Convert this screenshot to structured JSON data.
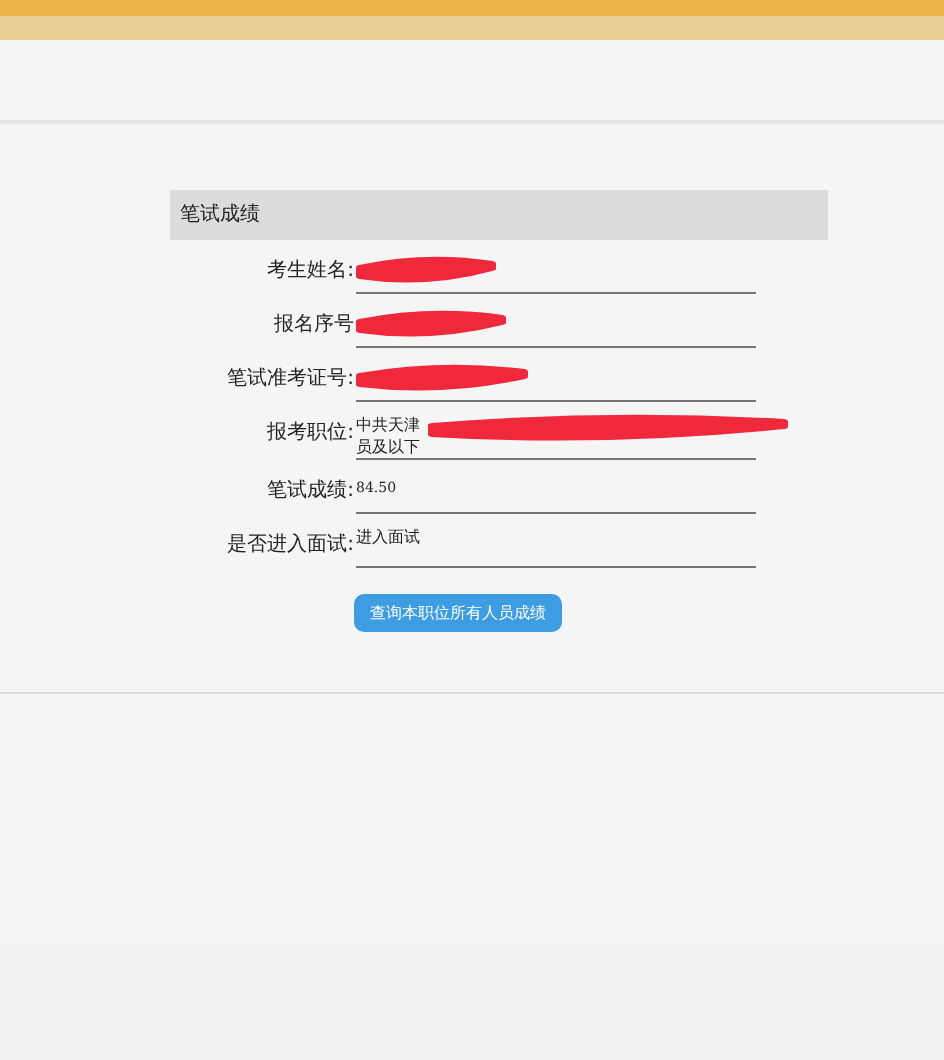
{
  "panel": {
    "title": "笔试成绩",
    "rows": [
      {
        "label": "考生姓名:",
        "redacted": true
      },
      {
        "label": "报名序号",
        "redacted": true
      },
      {
        "label": "笔试准考证号:",
        "redacted": true
      },
      {
        "label": "报考职位:",
        "value_lines": [
          "中共天津",
          "员及以下"
        ],
        "redacted": true
      },
      {
        "label": "笔试成绩:",
        "value_lines": [
          "84.50"
        ]
      },
      {
        "label": "是否进入面试:",
        "value_lines": [
          "进入面试"
        ]
      }
    ],
    "button": "查询本职位所有人员成绩"
  }
}
